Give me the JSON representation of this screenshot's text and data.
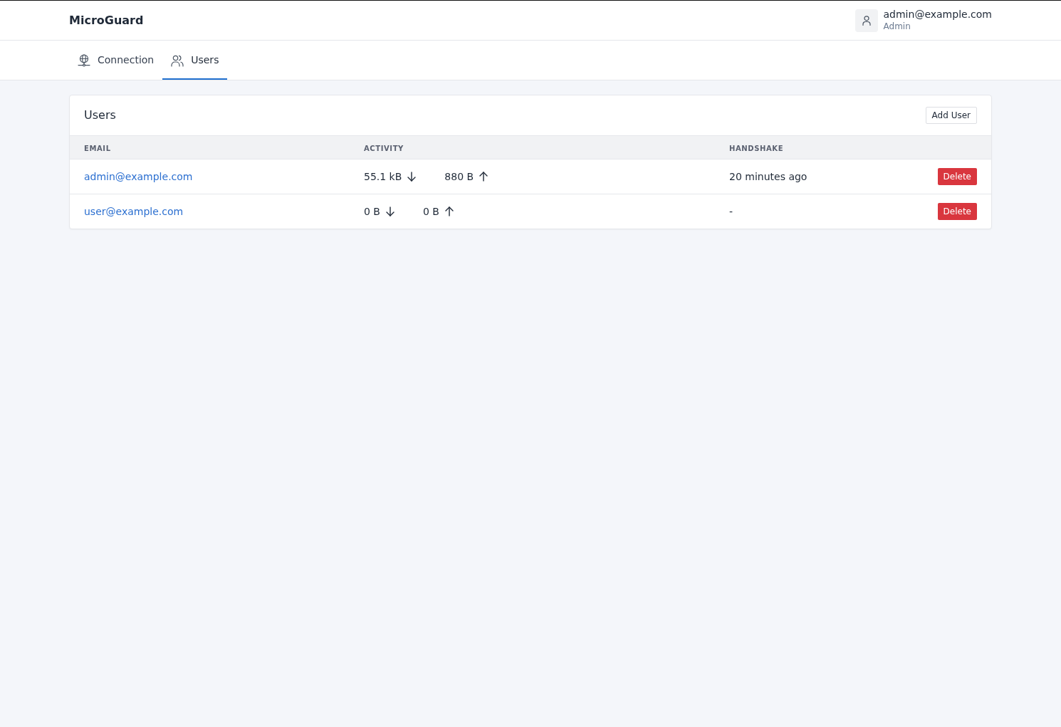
{
  "header": {
    "brand": "MicroGuard",
    "account": {
      "email": "admin@example.com",
      "role": "Admin"
    }
  },
  "tabs": [
    {
      "label": "Connection",
      "selected": false
    },
    {
      "label": "Users",
      "selected": true
    }
  ],
  "users_panel": {
    "title": "Users",
    "add_button": "Add User",
    "table": {
      "columns": [
        "EMAIL",
        "ACTIVITY",
        "HANDSHAKE"
      ],
      "rows": [
        {
          "email": "admin@example.com",
          "activity": [
            {
              "value": "55.1 kB",
              "kind": "received"
            },
            {
              "value": "880 B",
              "kind": "sent"
            }
          ],
          "handshake": "20 minutes ago",
          "action": "Delete"
        },
        {
          "email": "user@example.com",
          "activity": [
            {
              "value": "0 B",
              "kind": "received"
            },
            {
              "value": "0 B",
              "kind": "sent"
            }
          ],
          "handshake": "-",
          "action": "Delete"
        }
      ]
    }
  }
}
